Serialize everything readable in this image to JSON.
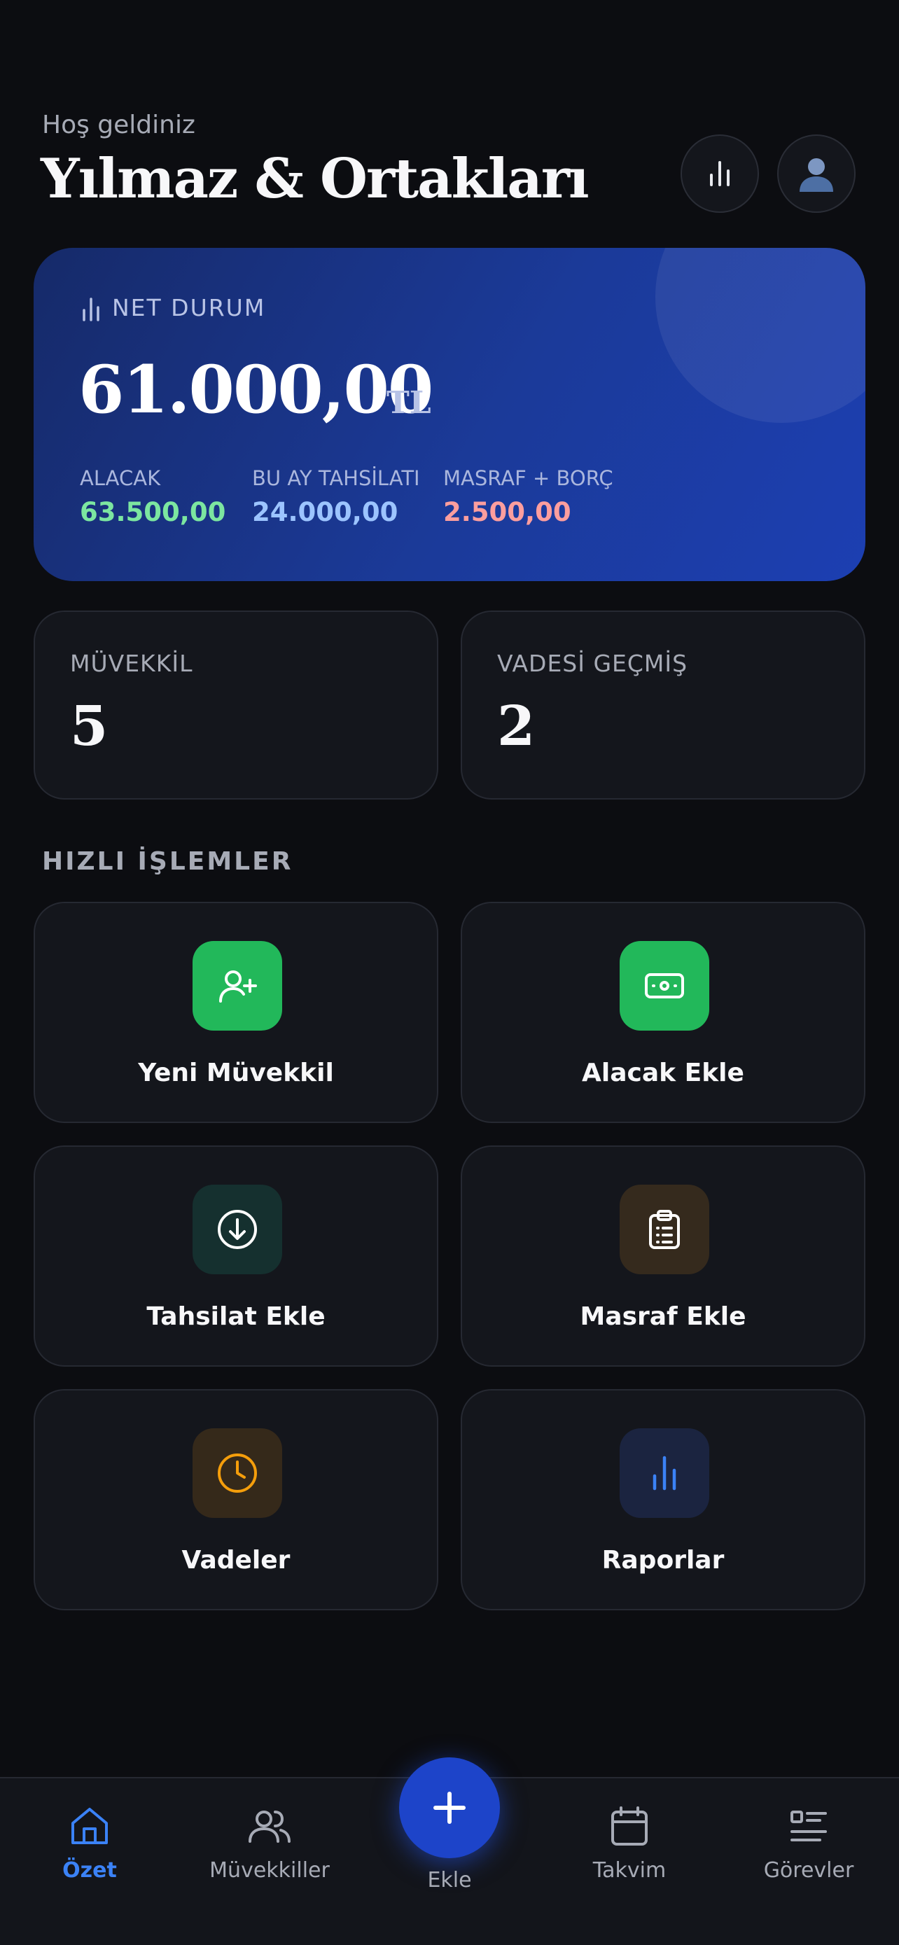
{
  "header": {
    "greeting": "Hoş geldiniz",
    "firm_name": "Yılmaz & Ortakları",
    "stats_button_icon": "bar-chart-icon",
    "profile_button_icon": "user-avatar-icon"
  },
  "net_status": {
    "label": "NET DURUM",
    "amount": "61.000,00",
    "currency": "TL",
    "stats": [
      {
        "label": "ALACAK",
        "value": "63.500,00",
        "color": "#7ce6a0"
      },
      {
        "label": "BU AY TAHSİLATI",
        "value": "24.000,00",
        "color": "#9cc4ff"
      },
      {
        "label": "MASRAF + BORÇ",
        "value": "2.500,00",
        "color": "#fc9e9e"
      }
    ]
  },
  "counts": [
    {
      "label": "MÜVEKKİL",
      "value": "5"
    },
    {
      "label": "VADESİ GEÇMİŞ",
      "value": "2"
    }
  ],
  "quick_actions": {
    "title": "HIZLI İŞLEMLER",
    "items": [
      {
        "label": "Yeni Müvekkil",
        "icon": "add-user-icon",
        "color": "#22b85a"
      },
      {
        "label": "Alacak Ekle",
        "icon": "money-icon",
        "color": "#22b85a"
      },
      {
        "label": "Tahsilat Ekle",
        "icon": "download-circle-icon",
        "color": "#15302f"
      },
      {
        "label": "Masraf Ekle",
        "icon": "clipboard-icon",
        "color": "#352a1d"
      },
      {
        "label": "Vadeler",
        "icon": "clock-icon",
        "color": "#35291a"
      },
      {
        "label": "Raporlar",
        "icon": "bar-chart-icon",
        "color": "#1b2440"
      }
    ]
  },
  "bottom_nav": {
    "items": [
      {
        "label": "Özet",
        "icon": "home-icon",
        "active": true
      },
      {
        "label": "Müvekkiller",
        "icon": "users-icon",
        "active": false
      },
      {
        "label": "Ekle",
        "icon": "plus-icon",
        "active": false
      },
      {
        "label": "Takvim",
        "icon": "calendar-icon",
        "active": false
      },
      {
        "label": "Görevler",
        "icon": "task-list-icon",
        "active": false
      }
    ],
    "accent_color": "#3b82f6"
  }
}
